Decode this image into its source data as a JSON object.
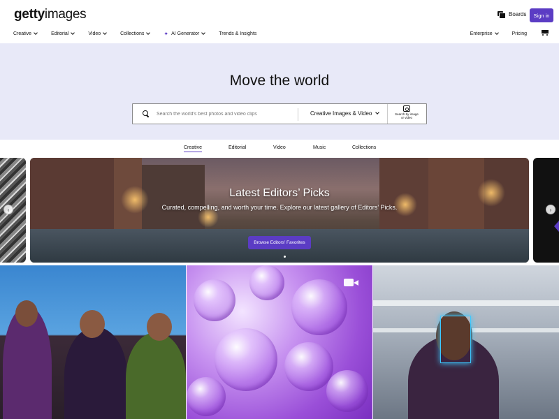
{
  "header": {
    "logo_bold": "getty",
    "logo_light": "images",
    "boards_label": "Boards",
    "signin_label": "Sign in"
  },
  "nav": {
    "left": [
      {
        "label": "Creative",
        "icon": "chevron-down-icon"
      },
      {
        "label": "Editorial",
        "icon": "chevron-down-icon"
      },
      {
        "label": "Video",
        "icon": "chevron-down-icon"
      },
      {
        "label": "Collections",
        "icon": "chevron-down-icon"
      },
      {
        "label": "AI Generator",
        "icon": "chevron-down-icon",
        "leading_icon": "sparkle-icon"
      },
      {
        "label": "Trends & Insights"
      }
    ],
    "right": [
      {
        "label": "Enterprise",
        "icon": "chevron-down-icon"
      },
      {
        "label": "Pricing"
      }
    ],
    "cart_icon": "cart-icon"
  },
  "hero": {
    "title": "Move the world",
    "search_placeholder": "Search the world's best photos and video clips",
    "scope_label": "Creative Images & Video",
    "search_by_image_line1": "Search by image",
    "search_by_image_line2": "or video"
  },
  "tabs": [
    {
      "label": "Creative",
      "active": true
    },
    {
      "label": "Editorial",
      "active": false
    },
    {
      "label": "Video",
      "active": false
    },
    {
      "label": "Music",
      "active": false
    },
    {
      "label": "Collections",
      "active": false
    }
  ],
  "carousel": {
    "title": "Latest Editors’ Picks",
    "subtitle": "Curated, compelling, and worth your time. Explore our latest gallery of Editors’ Picks.",
    "button_label": "Browse Editors’ Favorites",
    "prev_icon": "chevron-left-icon",
    "next_icon": "chevron-right-icon"
  },
  "colors": {
    "accent": "#5b3cc4",
    "hero_bg": "#e8e9f8"
  }
}
